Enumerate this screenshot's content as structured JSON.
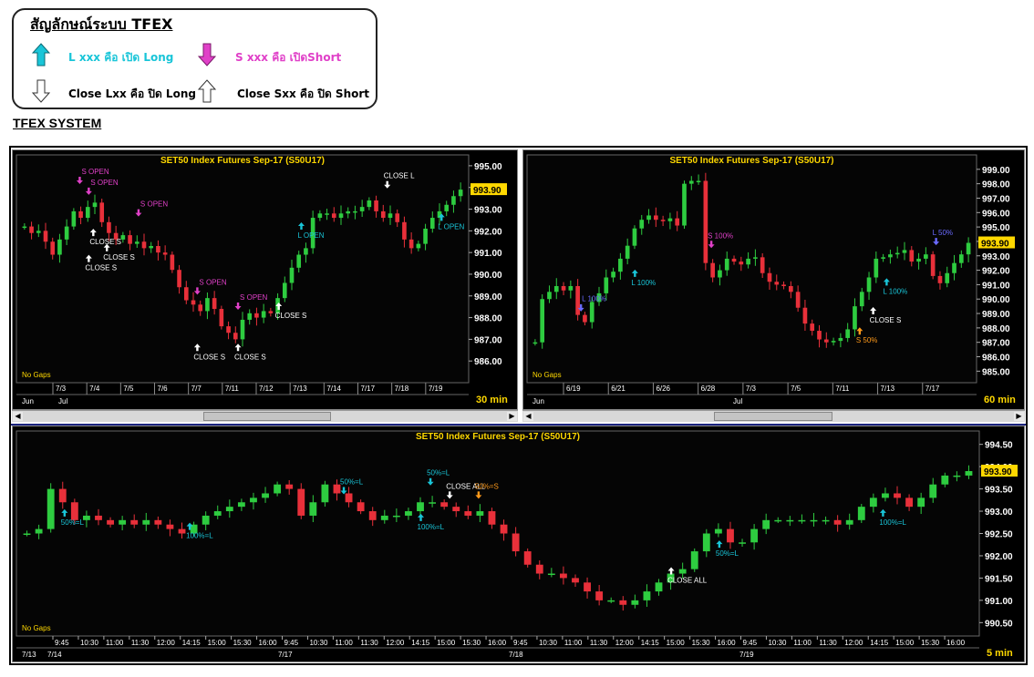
{
  "legend": {
    "title": "สัญลักษณ์ระบบ TFEX",
    "items": [
      {
        "icon": "up-arrow-cyan-icon",
        "text": "L xxx คือ เปิด Long",
        "color": "#19c5d8"
      },
      {
        "icon": "down-arrow-magenta-icon",
        "text": "S xxx คือ เปิดShort",
        "color": "#e040c8"
      },
      {
        "icon": "down-arrow-outline-icon",
        "text": "Close Lxx คือ ปิด Long",
        "color": "#000000"
      },
      {
        "icon": "up-arrow-outline-icon",
        "text": "Close Sxx คือ ปิด Short",
        "color": "#000000"
      }
    ]
  },
  "system_title": "TFEX SYSTEM",
  "colors": {
    "up": "#2ecc40",
    "down": "#e8303a",
    "price_tag": "#ffd800",
    "title": "#ffd800",
    "cyan": "#19c5d8",
    "magenta": "#e040c8",
    "white": "#ffffff",
    "orange": "#ff9a1a",
    "blue": "#6a6aff"
  },
  "chart_data": [
    {
      "type": "candlestick",
      "title": "SET50  Index  Futures  Sep-17  (S50U17)",
      "timeframe": "30  min",
      "no_gaps": "No  Gaps",
      "ylim": [
        985.0,
        995.5
      ],
      "yticks": [
        "995.00",
        "994.00",
        "993.00",
        "992.00",
        "991.00",
        "990.00",
        "989.00",
        "988.00",
        "987.00",
        "986.00"
      ],
      "last_price": "993.90",
      "x_date_labels": [
        "7/3",
        "7/4",
        "7/5",
        "7/6",
        "7/7",
        "7/11",
        "7/12",
        "7/13",
        "7/14",
        "7/17",
        "7/18",
        "7/19"
      ],
      "x_month_labels": [
        "Jun",
        "Jul"
      ],
      "series": [
        {
          "values": [
            992.2,
            991.9,
            992.0,
            991.5,
            990.9,
            991.6,
            992.2,
            992.9,
            992.6,
            993.1,
            993.3,
            992.4,
            991.9,
            991.6,
            991.8,
            991.4,
            991.5,
            991.2,
            991.3,
            991.0,
            990.9,
            990.2,
            989.4,
            988.8,
            988.6,
            988.3,
            988.9,
            988.4,
            987.6,
            987.3,
            987.0,
            987.9,
            988.2,
            988.0,
            988.3,
            988.2,
            988.9,
            989.6,
            990.3,
            990.9,
            991.2,
            992.6,
            992.8,
            992.8,
            992.6,
            992.8,
            992.9,
            992.9,
            993.1,
            993.4,
            992.9,
            992.6,
            992.8,
            992.4,
            991.6,
            991.2,
            991.4,
            992.1,
            992.6,
            992.9,
            993.2,
            993.6,
            993.9
          ]
        }
      ],
      "annotations": [
        {
          "label": "S  OPEN",
          "arrow": "down",
          "color": "magenta",
          "x": 0.14,
          "y": 994.2
        },
        {
          "label": "S  OPEN",
          "arrow": "down",
          "color": "magenta",
          "x": 0.16,
          "y": 993.7
        },
        {
          "label": "CLOSE  S",
          "arrow": "up",
          "color": "white",
          "x": 0.17,
          "y": 991.8
        },
        {
          "label": "S  OPEN",
          "arrow": "down",
          "color": "magenta",
          "x": 0.27,
          "y": 992.7
        },
        {
          "label": "CLOSE  S",
          "arrow": "up",
          "color": "white",
          "x": 0.2,
          "y": 991.1
        },
        {
          "label": "CLOSE  S",
          "arrow": "up",
          "color": "white",
          "x": 0.16,
          "y": 990.6
        },
        {
          "label": "S  OPEN",
          "arrow": "down",
          "color": "magenta",
          "x": 0.4,
          "y": 989.1
        },
        {
          "label": "S  OPEN",
          "arrow": "down",
          "color": "magenta",
          "x": 0.49,
          "y": 988.4
        },
        {
          "label": "CLOSE  S",
          "arrow": "up",
          "color": "white",
          "x": 0.58,
          "y": 988.4
        },
        {
          "label": "CLOSE  S",
          "arrow": "up",
          "color": "white",
          "x": 0.4,
          "y": 986.5
        },
        {
          "label": "CLOSE  S",
          "arrow": "up",
          "color": "white",
          "x": 0.49,
          "y": 986.5
        },
        {
          "label": "L  OPEN",
          "arrow": "up",
          "color": "cyan",
          "x": 0.63,
          "y": 992.1
        },
        {
          "label": "CLOSE  L",
          "arrow": "down",
          "color": "white",
          "x": 0.82,
          "y": 994.0
        },
        {
          "label": "L  OPEN",
          "arrow": "up",
          "color": "cyan",
          "x": 0.94,
          "y": 992.5
        }
      ]
    },
    {
      "type": "candlestick",
      "title": "SET50  Index  Futures  Sep-17  (S50U17)",
      "timeframe": "60  min",
      "no_gaps": "No  Gaps",
      "ylim": [
        984.2,
        1000.0
      ],
      "yticks": [
        "999.00",
        "998.00",
        "997.00",
        "996.00",
        "995.00",
        "994.00",
        "993.00",
        "992.00",
        "991.00",
        "990.00",
        "989.00",
        "988.00",
        "987.00",
        "986.00",
        "985.00"
      ],
      "last_price": "993.90",
      "x_date_labels": [
        "6/19",
        "6/21",
        "6/26",
        "6/28",
        "7/3",
        "7/5",
        "7/11",
        "7/13",
        "7/17"
      ],
      "x_month_labels": [
        "Jun",
        "Jul"
      ],
      "series": [
        {
          "values": [
            987.0,
            990.0,
            990.5,
            990.9,
            990.6,
            990.9,
            988.9,
            988.4,
            989.8,
            990.4,
            991.5,
            991.9,
            992.8,
            993.7,
            994.9,
            995.5,
            995.8,
            995.5,
            995.4,
            995.6,
            995.1,
            998.0,
            998.2,
            998.2,
            992.5,
            991.5,
            992.0,
            992.8,
            992.6,
            992.4,
            992.8,
            992.9,
            991.8,
            991.2,
            991.0,
            990.9,
            990.5,
            989.4,
            988.3,
            987.8,
            987.2,
            987.0,
            987.1,
            987.3,
            987.9,
            989.5,
            990.5,
            991.5,
            992.8,
            992.9,
            993.1,
            993.2,
            993.4,
            992.6,
            992.8,
            993.1,
            991.6,
            991.1,
            991.8,
            992.5,
            993.1,
            993.9
          ]
        }
      ],
      "annotations": [
        {
          "label": "L  100%",
          "arrow": "none",
          "color": "blue",
          "x": 0.13,
          "y": 990.5
        },
        {
          "label": "",
          "arrow": "down",
          "color": "blue",
          "x": 0.12,
          "y": 989.2
        },
        {
          "label": "L  100%",
          "arrow": "up",
          "color": "cyan",
          "x": 0.24,
          "y": 991.6
        },
        {
          "label": "S  100%",
          "arrow": "down",
          "color": "magenta",
          "x": 0.41,
          "y": 993.6
        },
        {
          "label": "CLOSE  S",
          "arrow": "up",
          "color": "white",
          "x": 0.77,
          "y": 989.0
        },
        {
          "label": "S  50%",
          "arrow": "up",
          "color": "orange",
          "x": 0.74,
          "y": 987.6
        },
        {
          "label": "L  100%",
          "arrow": "up",
          "color": "cyan",
          "x": 0.8,
          "y": 991.0
        },
        {
          "label": "L  50%",
          "arrow": "down",
          "color": "blue",
          "x": 0.91,
          "y": 993.8
        }
      ]
    },
    {
      "type": "candlestick",
      "title": "SET50  Index  Futures  Sep-17  (S50U17)",
      "timeframe": "5  min",
      "no_gaps": "No  Gaps",
      "ylim": [
        990.2,
        994.8
      ],
      "yticks": [
        "994.50",
        "994.00",
        "993.50",
        "993.00",
        "992.50",
        "992.00",
        "991.50",
        "991.00",
        "990.50"
      ],
      "last_price": "993.90",
      "x_time_labels": [
        "9:45",
        "10:30",
        "11:00",
        "11:30",
        "12:00",
        "14:15",
        "15:00",
        "15:30",
        "16:00",
        "9:45",
        "10:30",
        "11:00",
        "11:30",
        "12:00",
        "14:15",
        "15:00",
        "15:30",
        "16:00",
        "9:45",
        "10:30",
        "11:00",
        "11:30",
        "12:00",
        "14:15",
        "15:00",
        "15:30",
        "16:00",
        "9:45",
        "10:30",
        "11:00",
        "11:30",
        "12:00",
        "14:15",
        "15:00",
        "15:30",
        "16:00"
      ],
      "x_date_labels": [
        "7/13",
        "7/14",
        "7/17",
        "7/18",
        "7/19"
      ],
      "series": [
        {
          "values": [
            992.5,
            992.6,
            993.5,
            993.2,
            992.8,
            992.9,
            992.8,
            992.7,
            992.8,
            992.7,
            992.8,
            992.7,
            992.6,
            992.5,
            992.7,
            992.9,
            993.0,
            993.1,
            993.2,
            993.3,
            993.4,
            993.6,
            993.5,
            992.9,
            993.2,
            993.6,
            993.4,
            993.2,
            993.0,
            992.8,
            992.9,
            992.9,
            993.0,
            993.2,
            993.2,
            993.1,
            993.0,
            992.9,
            993.0,
            992.7,
            992.5,
            992.1,
            991.8,
            991.6,
            991.6,
            991.5,
            991.4,
            991.2,
            991.0,
            991.0,
            990.9,
            991.0,
            991.2,
            991.4,
            991.6,
            991.7,
            992.1,
            992.5,
            992.6,
            992.3,
            992.3,
            992.6,
            992.8,
            992.8,
            992.8,
            992.8,
            992.8,
            992.8,
            992.7,
            992.8,
            993.1,
            993.3,
            993.4,
            993.3,
            993.1,
            993.3,
            993.6,
            993.8,
            993.8,
            993.9
          ]
        }
      ],
      "annotations": [
        {
          "label": "50%=L",
          "arrow": "up",
          "color": "cyan",
          "x": 0.05,
          "y": 992.9
        },
        {
          "label": "100%=L",
          "arrow": "up",
          "color": "cyan",
          "x": 0.18,
          "y": 992.6
        },
        {
          "label": "50%=L",
          "arrow": "down",
          "color": "cyan",
          "x": 0.34,
          "y": 993.4
        },
        {
          "label": "100%=L",
          "arrow": "up",
          "color": "cyan",
          "x": 0.42,
          "y": 992.8
        },
        {
          "label": "50%=L",
          "arrow": "down",
          "color": "cyan",
          "x": 0.43,
          "y": 993.6
        },
        {
          "label": "CLOSE  ALL",
          "arrow": "down",
          "color": "white",
          "x": 0.45,
          "y": 993.3
        },
        {
          "label": "50%=S",
          "arrow": "down",
          "color": "orange",
          "x": 0.48,
          "y": 993.3
        },
        {
          "label": "CLOSE  ALL",
          "arrow": "up",
          "color": "white",
          "x": 0.68,
          "y": 991.6
        },
        {
          "label": "50%=L",
          "arrow": "up",
          "color": "cyan",
          "x": 0.73,
          "y": 992.2
        },
        {
          "label": "100%=L",
          "arrow": "up",
          "color": "cyan",
          "x": 0.9,
          "y": 992.9
        }
      ]
    }
  ]
}
